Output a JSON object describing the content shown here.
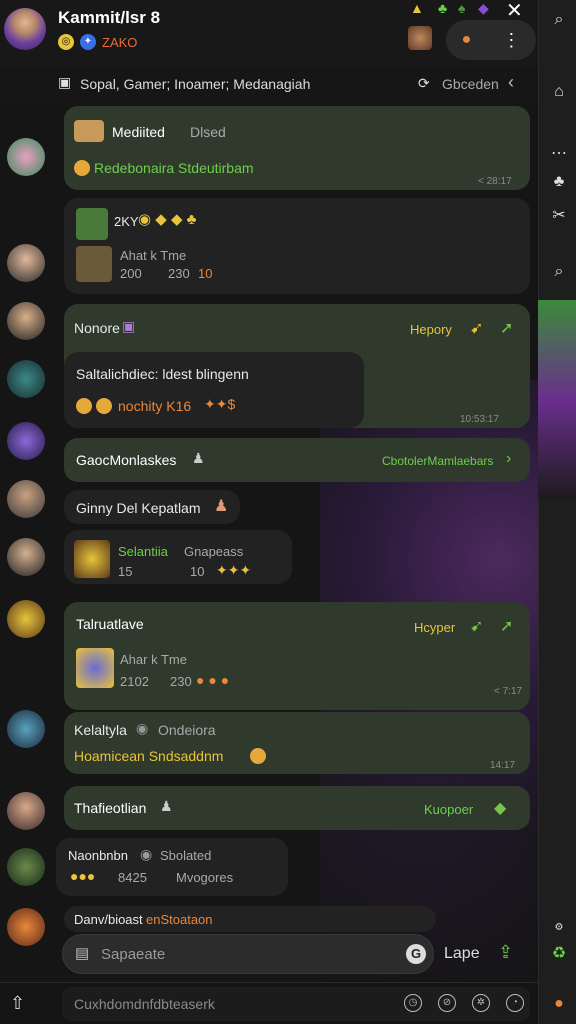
{
  "header": {
    "title": "Kammit/lsr 8",
    "subtitle": "ZAKO",
    "subtitle_color": "#e96b3a",
    "close_icon": "close-icon",
    "menu_icon": "more-vertical-icon"
  },
  "subbar": {
    "label": "Sopal, Gamer; Inoamer; Medanagiah",
    "right_label": "Gbceden"
  },
  "messages": [
    {
      "title": "Mediited",
      "title2": "Dlsed",
      "line2": "Redebonaira Stdeutirbam",
      "time": "< 28:17"
    },
    {
      "title": "2KY",
      "sub1": "Ahat k Tme",
      "sub2": "200",
      "sub3": "230",
      "sub4": "10"
    },
    {
      "title": "Nonore",
      "right": "Hepory"
    },
    {
      "title": "Saltalichdiec: ldest blingenn",
      "line2": "nochity K16",
      "time": "10:53:17"
    },
    {
      "title": "GaocMonlaskes",
      "right": "CbotolerMamlaebars"
    },
    {
      "title": "Ginny Del Kepatlam"
    },
    {
      "title": "Selantiia",
      "title2": "Gnapeass",
      "line2": "15",
      "line3": "10"
    },
    {
      "title": "Talruatlave",
      "right": "Hcyper",
      "sub1": "Ahar k Tme",
      "sub2": "2102",
      "sub3": "230"
    },
    {
      "title": "Kelaltyla",
      "title2": "Ondeiora",
      "line2": "Hoamicean Sndsaddnm",
      "time": "< 7:17",
      "time2": "14:17"
    },
    {
      "title": "Thafieotlian",
      "right": "Kuopoer"
    },
    {
      "title": "Naonbnbn",
      "title2": "Sbolated",
      "line2": "8425",
      "line3": "Mvogores"
    },
    {
      "title": "Danv/bioast",
      "title2": "enStoataon"
    }
  ],
  "input": {
    "placeholder": "Sapaeate",
    "send_label": "Lape"
  },
  "bottombar": {
    "placeholder": "Cuxhdomdnfdbteaserk"
  },
  "colors": {
    "bubble_green": "#2f3a2c",
    "bubble_dark": "#222222",
    "accent": "#6ecf4a"
  }
}
